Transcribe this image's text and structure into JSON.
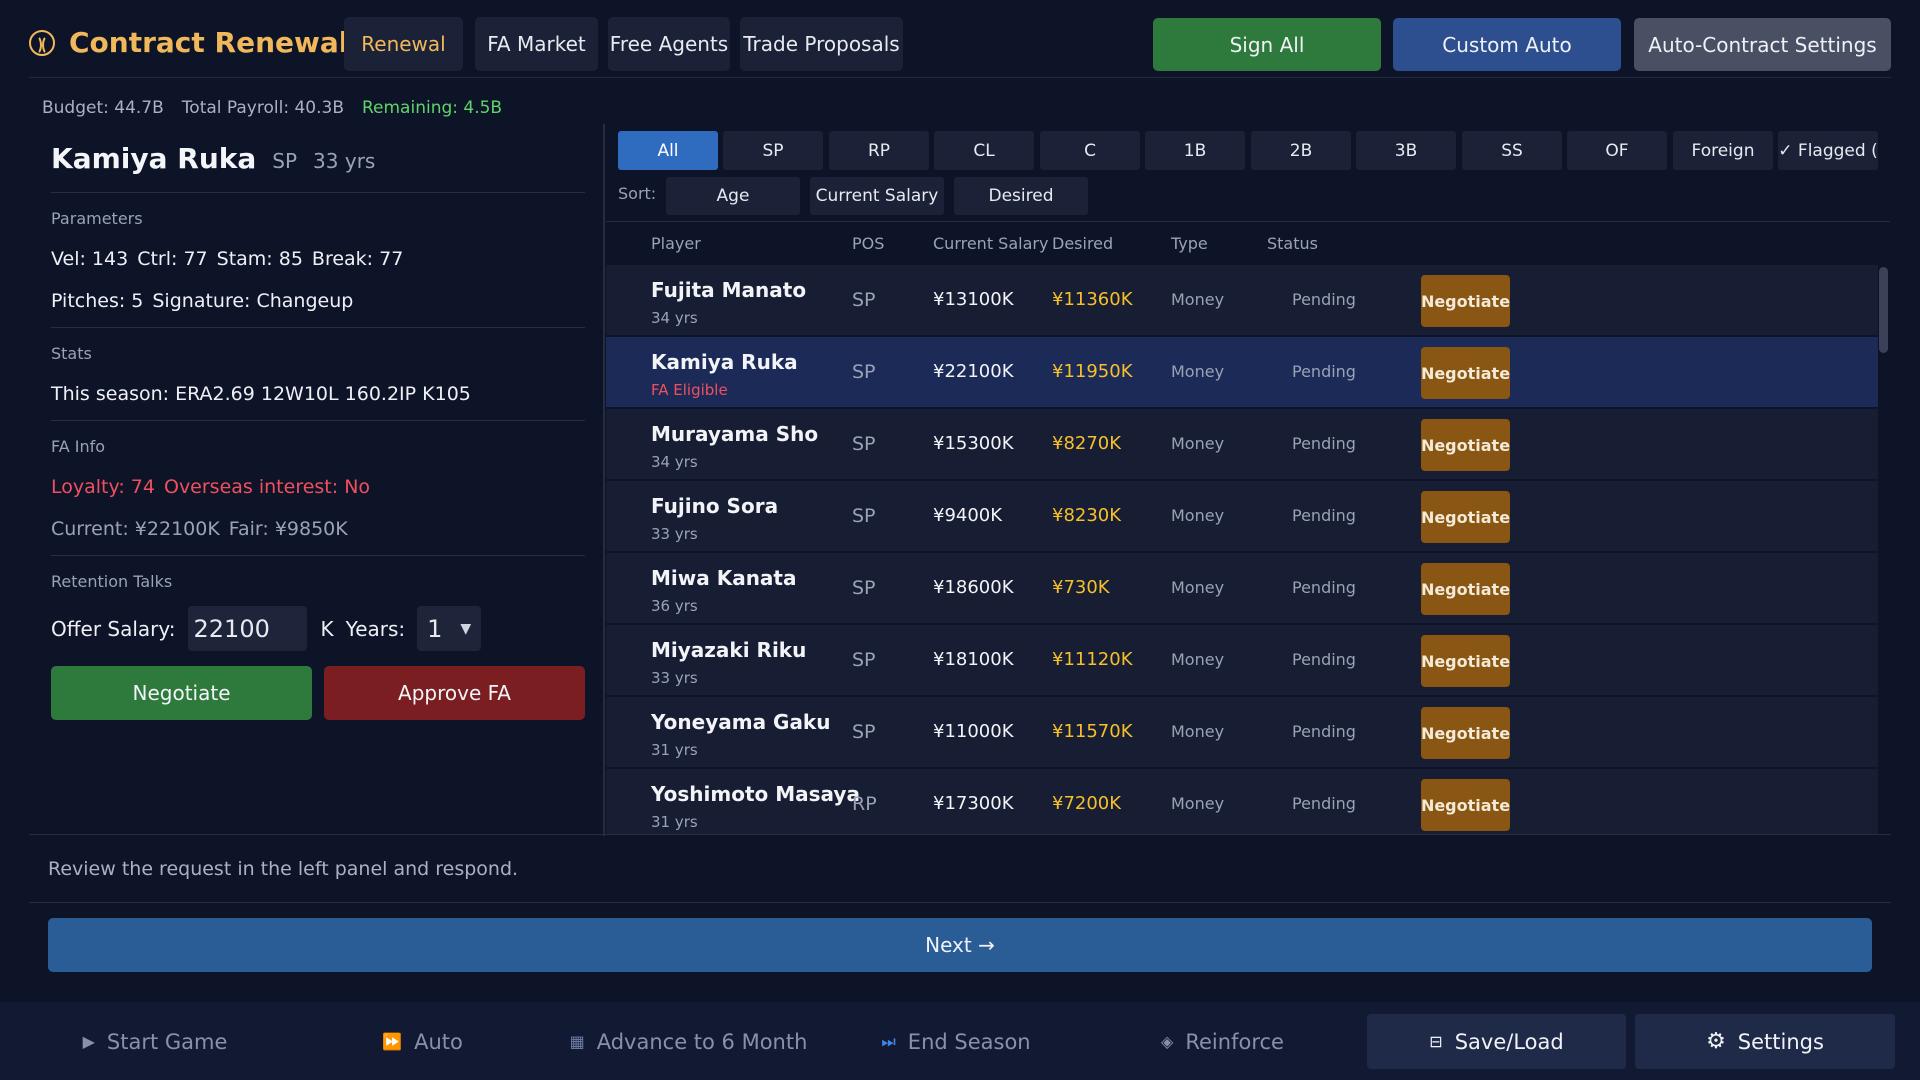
{
  "header": {
    "title": "Contract Renewal",
    "tabs": [
      "Renewal",
      "FA Market",
      "Free Agents",
      "Trade Proposals"
    ],
    "sign_all": "Sign All",
    "custom_auto": "Custom Auto",
    "auto_settings": "Auto-Contract Settings",
    "colors": {
      "accent": "#f0b85a",
      "sign_all": "#2e7a3c",
      "custom_auto": "#2d4f8f",
      "settings": "#4a5064"
    }
  },
  "budget": {
    "budget": "Budget: 44.7B",
    "payroll": "Total Payroll: 40.3B",
    "remaining": "Remaining: 4.5B"
  },
  "detail": {
    "name": "Kamiya Ruka",
    "pos": "SP",
    "age": "33 yrs",
    "params_title": "Parameters",
    "params_line1": [
      "Vel: 143",
      "Ctrl: 77",
      "Stam: 85",
      "Break: 77"
    ],
    "params_line2": [
      "Pitches: 5",
      "Signature: Changeup"
    ],
    "stats_title": "Stats",
    "stats_line": "This season: ERA2.69 12W10L 160.2IP K105",
    "fa_title": "FA Info",
    "fa_line1": [
      "Loyalty: 74",
      "Overseas interest: No"
    ],
    "fa_line2": [
      "Current: ¥22100K",
      "Fair: ¥9850K"
    ],
    "retention_title": "Retention Talks",
    "offer_label": "Offer Salary:",
    "offer_value": "22100",
    "offer_unit": "K",
    "years_label": "Years:",
    "years_value": "1",
    "negotiate": "Negotiate",
    "approve_fa": "Approve FA"
  },
  "filters": [
    "All",
    "SP",
    "RP",
    "CL",
    "C",
    "1B",
    "2B",
    "3B",
    "SS",
    "OF",
    "Foreign",
    "✓ Flagged ("
  ],
  "sort": {
    "label": "Sort:",
    "options": [
      "Age",
      "Current Salary",
      "Desired"
    ]
  },
  "table": {
    "columns": [
      "Player",
      "POS",
      "Current Salary",
      "Desired",
      "Type",
      "Status"
    ],
    "rows": [
      {
        "name": "Fujita Manato",
        "sub": "34 yrs",
        "pos": "SP",
        "current": "¥13100K",
        "desired": "¥11360K",
        "type": "Money",
        "status": "Pending",
        "action": "Negotiate"
      },
      {
        "name": "Kamiya Ruka",
        "sub": "FA Eligible",
        "pos": "SP",
        "current": "¥22100K",
        "desired": "¥11950K",
        "type": "Money",
        "status": "Pending",
        "action": "Negotiate"
      },
      {
        "name": "Murayama Sho",
        "sub": "34 yrs",
        "pos": "SP",
        "current": "¥15300K",
        "desired": "¥8270K",
        "type": "Money",
        "status": "Pending",
        "action": "Negotiate"
      },
      {
        "name": "Fujino Sora",
        "sub": "33 yrs",
        "pos": "SP",
        "current": "¥9400K",
        "desired": "¥8230K",
        "type": "Money",
        "status": "Pending",
        "action": "Negotiate"
      },
      {
        "name": "Miwa Kanata",
        "sub": "36 yrs",
        "pos": "SP",
        "current": "¥18600K",
        "desired": "¥730K",
        "type": "Money",
        "status": "Pending",
        "action": "Negotiate"
      },
      {
        "name": "Miyazaki Riku",
        "sub": "33 yrs",
        "pos": "SP",
        "current": "¥18100K",
        "desired": "¥11120K",
        "type": "Money",
        "status": "Pending",
        "action": "Negotiate"
      },
      {
        "name": "Yoneyama Gaku",
        "sub": "31 yrs",
        "pos": "SP",
        "current": "¥11000K",
        "desired": "¥11570K",
        "type": "Money",
        "status": "Pending",
        "action": "Negotiate"
      },
      {
        "name": "Yoshimoto Masaya",
        "sub": "31 yrs",
        "pos": "RP",
        "current": "¥17300K",
        "desired": "¥7200K",
        "type": "Money",
        "status": "Pending",
        "action": "Negotiate"
      }
    ]
  },
  "hint": "Review the request in the left panel and respond.",
  "next": "Next →",
  "footer": {
    "start_game": "Start Game",
    "auto": "Auto",
    "advance": "Advance to 6 Month",
    "end_season": "End Season",
    "reinforce": "Reinforce",
    "save_load": "Save/Load",
    "settings": "Settings"
  }
}
